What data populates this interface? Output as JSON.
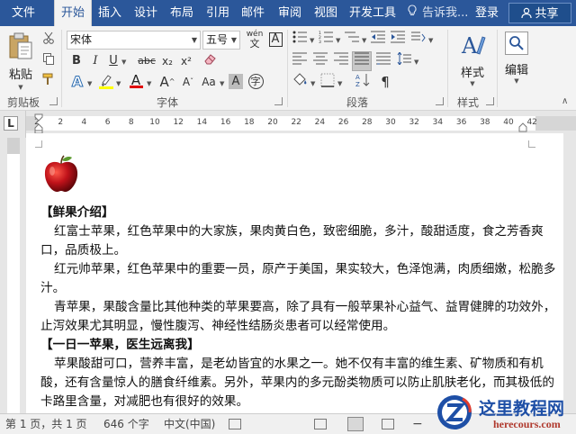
{
  "tabs": {
    "file": "文件",
    "home": "开始",
    "insert": "插入",
    "design": "设计",
    "layout": "布局",
    "references": "引用",
    "mailings": "邮件",
    "review": "审阅",
    "view": "视图",
    "developer": "开发工具"
  },
  "tell_me": "告诉我...",
  "login": "登录",
  "share": "共享",
  "ribbon": {
    "paste_label": "粘贴",
    "clipboard_group": "剪贴板",
    "font_name": "宋体",
    "font_size": "五号",
    "font_group": "字体",
    "paragraph_group": "段落",
    "styles_label": "样式",
    "styles_group": "样式",
    "editing_label": "编辑",
    "wen_label": "wén",
    "bold": "B",
    "italic": "I",
    "underline": "U",
    "strike": "abc",
    "subscript": "x₂",
    "superscript": "x²",
    "text_effect": "A",
    "font_color": "A",
    "grow_font": "A",
    "shrink_font": "A",
    "aa_case": "Aa",
    "char_shade": "A",
    "char_border": "A"
  },
  "ruler": {
    "corner": "L",
    "numbers": [
      "2",
      "2",
      "4",
      "6",
      "8",
      "10",
      "12",
      "14",
      "16",
      "18",
      "20",
      "22",
      "24",
      "26",
      "28",
      "30",
      "32",
      "34",
      "36",
      "38",
      "40",
      "42"
    ]
  },
  "document": {
    "heading1": "【鲜果介绍】",
    "p1": "红富士苹果，红色苹果中的大家族，果肉黄白色，致密细脆，多汁，酸甜适度，食之芳香爽口，品质极上。",
    "p2": "红元帅苹果，红色苹果中的重要一员，原产于美国，果实较大，色泽饱满，肉质细嫩，松脆多汁。",
    "p3": "青苹果，果酸含量比其他种类的苹果要高，除了具有一般苹果补心益气、益胃健脾的功效外，止泻效果尤其明显，慢性腹泻、神经性结肠炎患者可以经常使用。",
    "heading2": "【一日一苹果，医生远离我】",
    "p4": "苹果酸甜可口，营养丰富，是老幼皆宜的水果之一。她不仅有丰富的维生素、矿物质和有机酸，还有含量惊人的膳食纤维素。另外，苹果内的多元酚类物质可以防止肌肤老化，而其极低的卡路里含量，对减肥也有很好的效果。"
  },
  "status": {
    "page": "第 1 页，共 1 页",
    "words": "646 个字",
    "language": "中文(中国)"
  },
  "watermark": {
    "name": "这里教程网",
    "url": "herecours.com"
  },
  "colors": {
    "brand": "#2b579a",
    "highlight": "#ffff00",
    "font_color": "#e00000"
  }
}
